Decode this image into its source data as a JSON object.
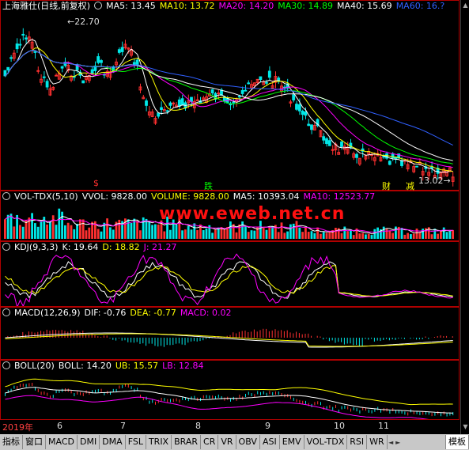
{
  "main": {
    "title": "上海雅仕(日线,前复权)",
    "ma": [
      {
        "label": "MA5: 13.45",
        "color": "#ffffff"
      },
      {
        "label": "MA10: 13.72",
        "color": "#ffff00"
      },
      {
        "label": "MA20: 14.20",
        "color": "#ff00ff"
      },
      {
        "label": "MA30: 14.89",
        "color": "#00ff00"
      },
      {
        "label": "MA40: 15.69",
        "color": "#ffffff"
      },
      {
        "label": "MA60: 16.?",
        "color": "#3060ff"
      }
    ],
    "high_label": "22.70",
    "low_label": "13.02",
    "markers": [
      {
        "text": "$",
        "color": "#ff3030"
      },
      {
        "text": "跌",
        "color": "#00ff00"
      },
      {
        "text": "财",
        "color": "#ffff00"
      },
      {
        "text": "减",
        "color": "#ffff00"
      }
    ]
  },
  "vol": {
    "title": "VOL-TDX(5,10)",
    "vvol": "VVOL: 9828.00",
    "volume": "VOLUME: 9828.00",
    "ma5": "MA5: 10393.04",
    "ma10": "MA10: 12523.77",
    "watermark": "www.eweb.net.cn"
  },
  "kdj": {
    "title": "KDJ(9,3,3)",
    "k": "K: 19.64",
    "d": "D: 18.82",
    "j": "J: 21.27"
  },
  "macd": {
    "title": "MACD(12,26,9)",
    "dif": "DIF: -0.76",
    "dea": "DEA: -0.77",
    "macd": "MACD: 0.02"
  },
  "boll": {
    "title": "BOLL(20)",
    "boll": "BOLL: 14.20",
    "ub": "UB: 15.57",
    "lb": "LB: 12.84"
  },
  "time_axis": [
    "2019年",
    "6",
    "7",
    "8",
    "9",
    "10",
    "11"
  ],
  "tabs": [
    "指标",
    "窗口",
    "MACD",
    "DMI",
    "DMA",
    "FSL",
    "TRIX",
    "BRAR",
    "CR",
    "VR",
    "OBV",
    "ASI",
    "EMV",
    "VOL-TDX",
    "RSI",
    "WR"
  ],
  "right_tab": "模板"
}
